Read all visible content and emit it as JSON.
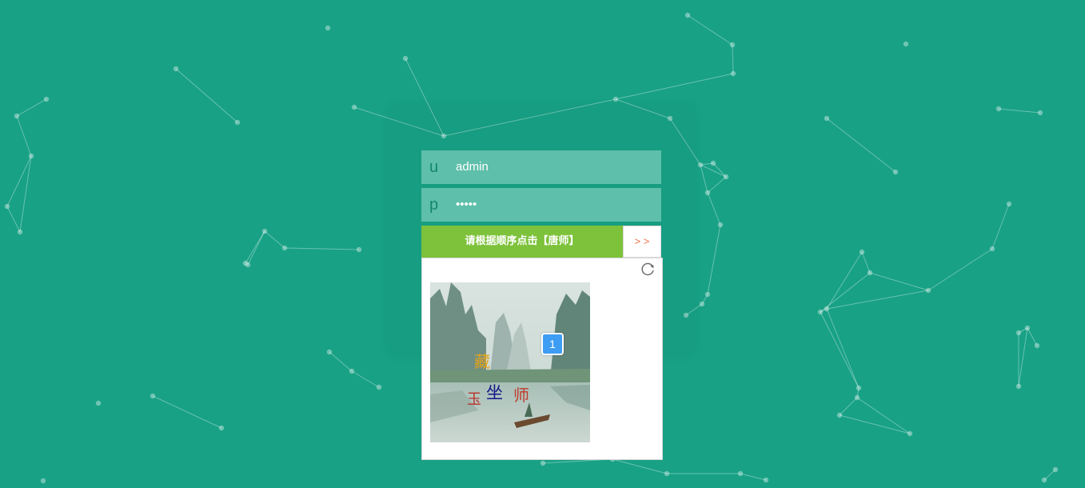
{
  "login": {
    "username_prefix": "u",
    "username_value": "admin",
    "password_prefix": "p",
    "password_value": "•••••"
  },
  "captcha": {
    "prompt": "请根据顺序点击【唐师】",
    "next_label": "> >",
    "refresh_icon": "refresh-icon",
    "chars": [
      {
        "text": "藏",
        "color": "#e8a317"
      },
      {
        "text": "玉",
        "color": "#b8322d"
      },
      {
        "text": "坐",
        "color": "#12158a"
      },
      {
        "text": "师",
        "color": "#c0392b"
      }
    ],
    "marker": "1"
  },
  "colors": {
    "background": "#18a185",
    "field": "#5ebfaa",
    "prompt_bar": "#7dc23a",
    "next_text": "#f0744a",
    "marker": "#3d9df2"
  }
}
